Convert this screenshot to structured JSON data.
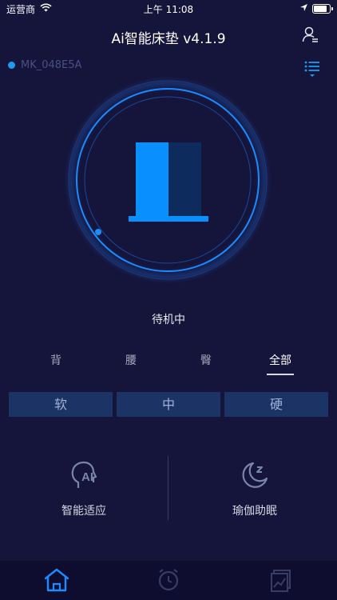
{
  "status_bar": {
    "carrier": "运营商",
    "time": "上午 11:08"
  },
  "header": {
    "title": "Ai智能床垫 v4.1.9"
  },
  "device": {
    "name": "MK_048E5A",
    "status_color": "#1d9bf0"
  },
  "status": {
    "text": "待机中"
  },
  "zones": {
    "items": [
      {
        "label": "背"
      },
      {
        "label": "腰"
      },
      {
        "label": "臀"
      },
      {
        "label": "全部"
      }
    ],
    "selected": "全部"
  },
  "firmness": {
    "soft": "软",
    "medium": "中",
    "hard": "硬"
  },
  "features": {
    "smart_adapt": {
      "label": "智能适应",
      "icon": "head-ai-icon"
    },
    "yoga_sleep": {
      "label": "瑜伽助眠",
      "icon": "moon-sleep-icon"
    }
  },
  "tabbar": {
    "items": [
      {
        "icon": "home-icon",
        "active": true
      },
      {
        "icon": "alarm-clock-icon",
        "active": false
      },
      {
        "icon": "report-icon",
        "active": false
      }
    ]
  },
  "colors": {
    "background": "#15143a",
    "accent": "#0a8fff",
    "accent_dark": "#0e2b5e",
    "button_bg": "#1b3365"
  }
}
